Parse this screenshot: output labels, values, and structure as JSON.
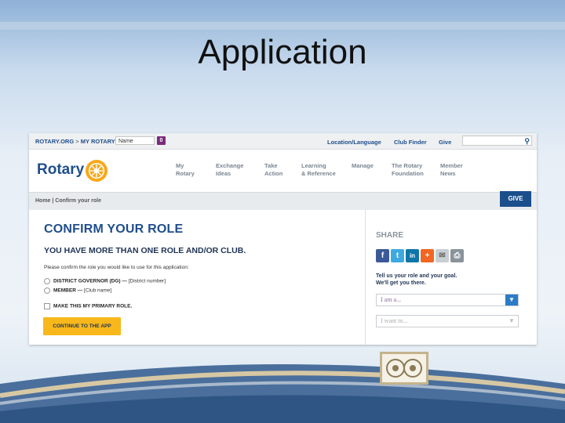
{
  "slide": {
    "title": "Application"
  },
  "topbar": {
    "breadcrumb_root": "ROTARY.ORG",
    "breadcrumb_sep": ">",
    "breadcrumb_current": "MY ROTARY",
    "name_placeholder": "Name",
    "badge_count": "0",
    "links": [
      "Location/Language",
      "Club Finder",
      "Give"
    ]
  },
  "header": {
    "logo": "Rotary",
    "nav": [
      {
        "line1": "My",
        "line2": "Rotary"
      },
      {
        "line1": "Exchange",
        "line2": "Ideas"
      },
      {
        "line1": "Take",
        "line2": "Action"
      },
      {
        "line1": "Learning",
        "line2": "& Reference"
      },
      {
        "line1": "Manage",
        "line2": ""
      },
      {
        "line1": "The Rotary",
        "line2": "Foundation"
      },
      {
        "line1": "Member",
        "line2": "News"
      }
    ]
  },
  "subbar": {
    "breadcrumb": "Home | Confirm your role",
    "give": "GIVE"
  },
  "main": {
    "title": "CONFIRM YOUR ROLE",
    "subtitle": "YOU HAVE MORE THAN ONE ROLE AND/OR CLUB.",
    "instructions": "Please confirm the role you would like to use for this application:",
    "options": [
      {
        "label": "DISTRICT GOVERNOR (DG) —",
        "detail": "[District number]"
      },
      {
        "label": "MEMBER —",
        "detail": "[Club name]"
      }
    ],
    "primary_checkbox": "MAKE THIS MY PRIMARY ROLE.",
    "cta": "CONTINUE TO THE APP"
  },
  "side": {
    "share_title": "SHARE",
    "share_icons": [
      "facebook-icon",
      "twitter-icon",
      "linkedin-icon",
      "plus-icon",
      "email-icon",
      "print-icon"
    ],
    "tell_line1": "Tell us your role and your goal.",
    "tell_line2": "We'll get you there.",
    "select_role": "I am a...",
    "select_goal": "I want to..."
  },
  "colors": {
    "brand_blue": "#1f4e8c",
    "gold": "#f8b81b",
    "give_blue": "#1a4f8b"
  }
}
